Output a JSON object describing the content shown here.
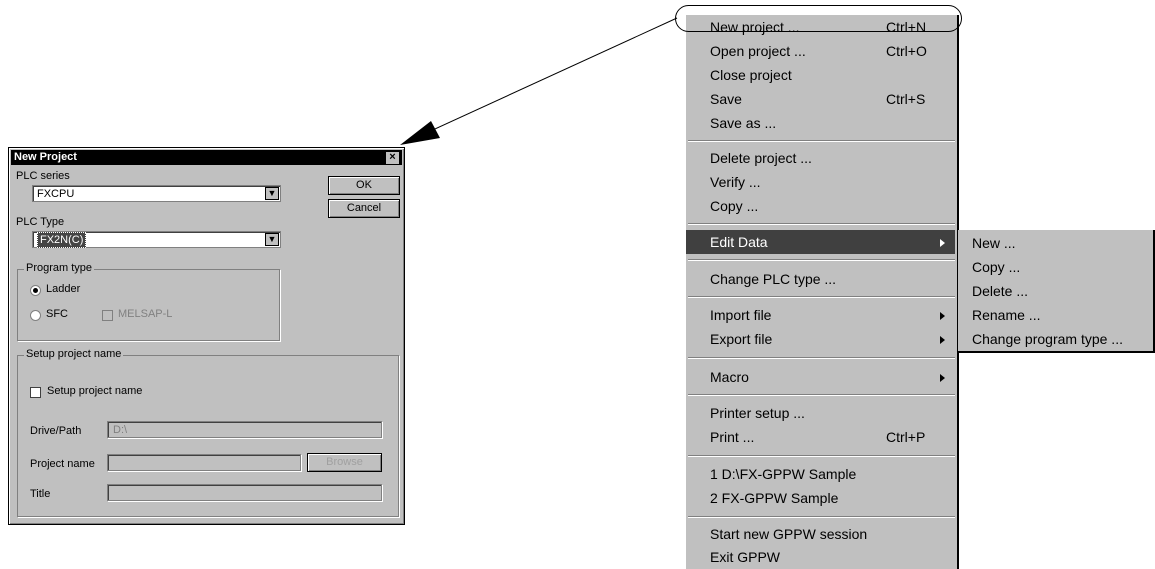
{
  "dialog": {
    "title": "New Project",
    "close": "×",
    "plc_series_label": "PLC series",
    "plc_series_value": "FXCPU",
    "plc_type_label": "PLC Type",
    "plc_type_value": "FX2N(C)",
    "ok_label": "OK",
    "cancel_label": "Cancel",
    "program_type": {
      "title": "Program type",
      "ladder": "Ladder",
      "sfc": "SFC",
      "melsap": "MELSAP-L"
    },
    "setup": {
      "title": "Setup project name",
      "checkbox_label": "Setup project name",
      "drive_label": "Drive/Path",
      "drive_value": "D:\\",
      "project_label": "Project name",
      "browse_label": "Browse",
      "title_label": "Title"
    }
  },
  "menu": {
    "items": [
      {
        "label": "New project ...",
        "shortcut": "Ctrl+N"
      },
      {
        "label": "Open project ...",
        "shortcut": "Ctrl+O"
      },
      {
        "label": "Close project",
        "shortcut": ""
      },
      {
        "label": "Save",
        "shortcut": "Ctrl+S"
      },
      {
        "label": "Save as ...",
        "shortcut": ""
      },
      {
        "label": "Delete project ...",
        "shortcut": ""
      },
      {
        "label": "Verify ...",
        "shortcut": ""
      },
      {
        "label": "Copy ...",
        "shortcut": ""
      },
      {
        "label": "Edit Data",
        "shortcut": ""
      },
      {
        "label": "Change PLC type ...",
        "shortcut": ""
      },
      {
        "label": "Import file",
        "shortcut": ""
      },
      {
        "label": "Export file",
        "shortcut": ""
      },
      {
        "label": "Macro",
        "shortcut": ""
      },
      {
        "label": "Printer setup ...",
        "shortcut": ""
      },
      {
        "label": "Print ...",
        "shortcut": "Ctrl+P"
      },
      {
        "label": "1 D:\\FX-GPPW Sample",
        "shortcut": ""
      },
      {
        "label": "2 FX-GPPW Sample",
        "shortcut": ""
      },
      {
        "label": "Start new GPPW session",
        "shortcut": ""
      },
      {
        "label": "Exit GPPW",
        "shortcut": ""
      }
    ]
  },
  "submenu": {
    "items": [
      "New ...",
      "Copy ...",
      "Delete ...",
      "Rename ...",
      "Change program type ..."
    ]
  },
  "colors": {
    "highlight": "#404040",
    "face": "#c0c0c0"
  }
}
